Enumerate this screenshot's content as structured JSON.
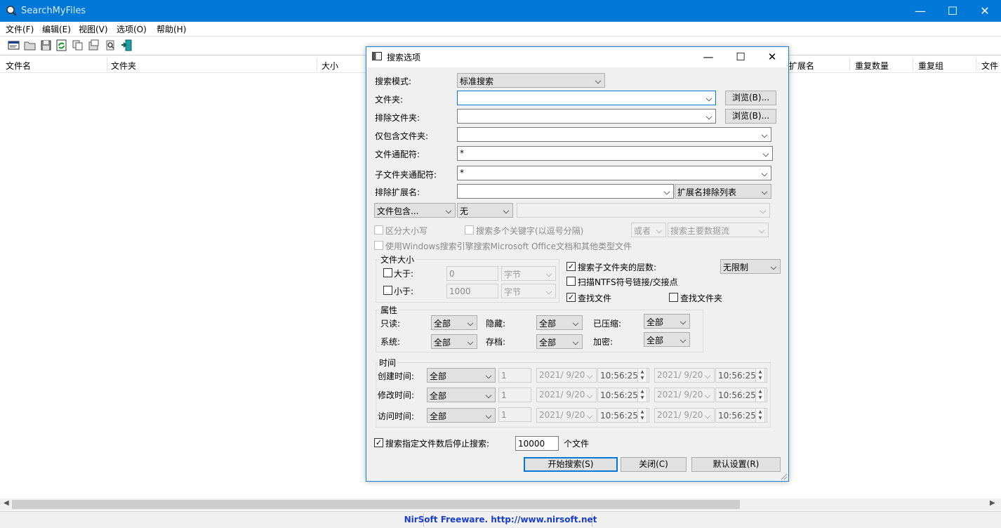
{
  "app": {
    "title": "SearchMyFiles"
  },
  "window_controls": {
    "minimize": "—",
    "maximize": "☐",
    "close": "✕"
  },
  "menu": [
    "文件(F)",
    "编辑(E)",
    "视图(V)",
    "选项(O)",
    "帮助(H)"
  ],
  "toolbar": [
    "properties-icon",
    "open-folder-icon",
    "save-icon",
    "refresh-icon",
    "copy-icon",
    "html-report-icon",
    "search-options-icon",
    "exit-icon"
  ],
  "columns": [
    "文件名",
    "文件夹",
    "大小",
    "扩展名",
    "重复数量",
    "重复组",
    "文件"
  ],
  "status": {
    "text": "NirSoft Freeware.  http://www.nirsoft.net"
  },
  "dialog": {
    "title": "搜索选项",
    "search_mode_label": "搜索模式:",
    "search_mode_value": "标准搜索",
    "folder_label": "文件夹:",
    "folder_value": "",
    "browse_label": "浏览(B)...",
    "exclude_folder_label": "排除文件夹:",
    "include_only_label": "仅包含文件夹:",
    "wildcard_label": "文件通配符:",
    "wildcard_value": "*",
    "subfolder_wildcard_label": "子文件夹通配符:",
    "subfolder_wildcard_value": "*",
    "exclude_ext_label": "排除扩展名:",
    "ext_list_value": "扩展名排除列表",
    "contains_value": "文件包含...",
    "contains_mode_value": "无",
    "case_label": "区分大小写",
    "multi_keywords_label": "搜索多个关键字(以逗号分隔)",
    "or_value": "或者",
    "main_stream_value": "搜索主要数据流",
    "windows_search_label": "使用Windows搜索引擎搜索Microsoft Office文档和其他类型文件",
    "size_group_title": "文件大小",
    "larger_label": "大于:",
    "smaller_label": "小于:",
    "larger_value": "0",
    "smaller_value": "1000",
    "unit_value": "字节",
    "subfolder_depth_label": "搜索子文件夹的层数:",
    "depth_value": "无限制",
    "ntfs_label": "扫描NTFS符号链接/交接点",
    "find_files_label": "查找文件",
    "find_folders_label": "查找文件夹",
    "attr_group_title": "属性",
    "readonly_label": "只读:",
    "hidden_label": "隐藏:",
    "compressed_label": "已压缩:",
    "system_label": "系统:",
    "archive_label": "存档:",
    "encrypted_label": "加密:",
    "all_value": "全部",
    "time_group_title": "时间",
    "created_label": "创建时间:",
    "modified_label": "修改时间:",
    "accessed_label": "访问时间:",
    "num_value": "1",
    "date_value": "2021/ 9/20",
    "time_value": "10:56:25",
    "stop_label": "搜索指定文件数后停止搜索:",
    "stop_value": "10000",
    "files_unit": "个文件",
    "start_button": "开始搜索(S)",
    "close_button": "关闭(C)",
    "default_button": "默认设置(R)"
  },
  "colors": {
    "titlebar": "#0078d7",
    "dialog_bg": "#f0f0f0",
    "status_text": "#1a3ec8"
  }
}
